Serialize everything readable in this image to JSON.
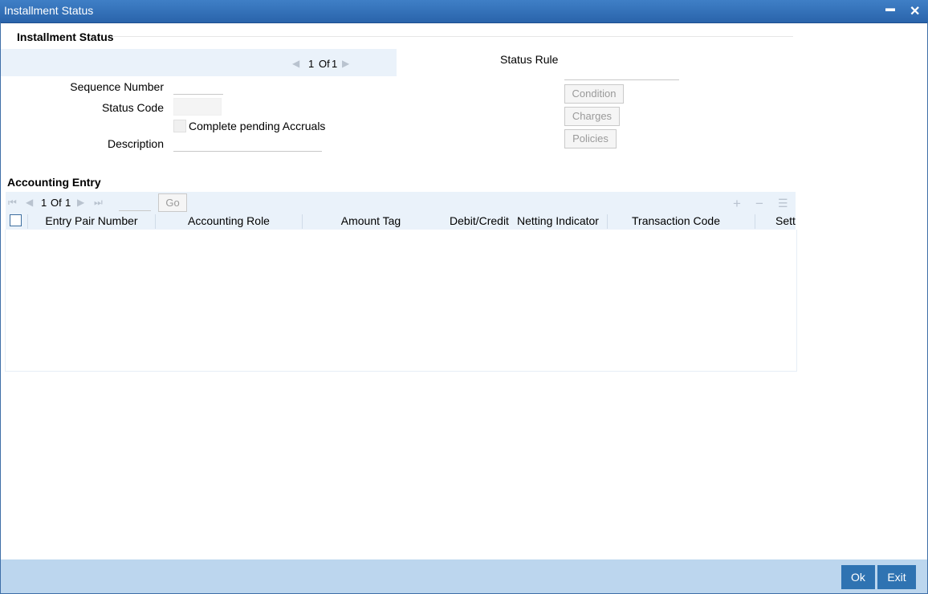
{
  "window": {
    "title": "Installment Status",
    "minimize_label": "▬",
    "close_label": "✕"
  },
  "header": {
    "section_title": "Installment Status",
    "pager_current": "1",
    "pager_of": "Of",
    "pager_total": "1",
    "prev_icon": "◀",
    "next_icon": "▶"
  },
  "form": {
    "sequence_number_label": "Sequence Number",
    "sequence_number_value": "",
    "status_code_label": "Status Code",
    "status_code_value": "",
    "complete_pending_label": "Complete pending Accruals",
    "complete_pending_checked": false,
    "description_label": "Description",
    "description_value": "",
    "status_rule_label": "Status Rule",
    "status_rule_value": ""
  },
  "side_buttons": {
    "condition": "Condition",
    "charges": "Charges",
    "policies": "Policies"
  },
  "accounting": {
    "section_title": "Accounting Entry",
    "pager_current": "1",
    "pager_of": "Of",
    "pager_total": "1",
    "go_label": "Go",
    "first_icon": "⏮",
    "prev_icon": "◀",
    "next_icon": "▶",
    "last_icon": "⏭",
    "add_icon": "+",
    "remove_icon": "−",
    "list_icon": "☰",
    "columns": [
      "Entry Pair Number",
      "Accounting Role",
      "Amount Tag",
      "Debit/Credit",
      "Netting Indicator",
      "Transaction Code",
      "Sett"
    ],
    "rows": []
  },
  "footer": {
    "ok_label": "Ok",
    "exit_label": "Exit"
  }
}
